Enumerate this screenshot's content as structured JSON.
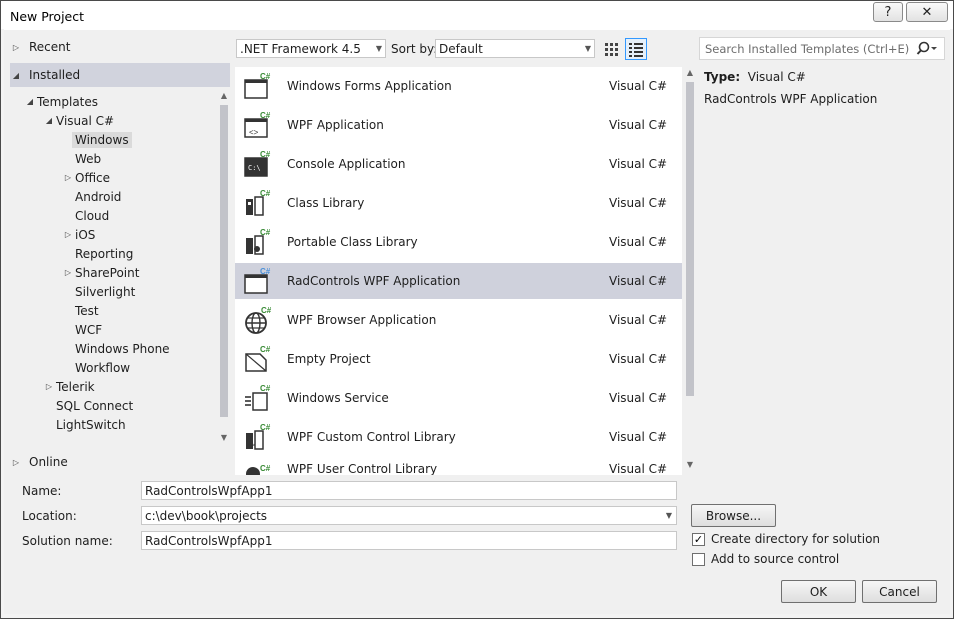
{
  "window": {
    "title": "New Project",
    "help": "?",
    "close": "✕"
  },
  "nav": {
    "recent": "Recent",
    "installed": "Installed",
    "online": "Online",
    "tree": [
      {
        "label": "Templates"
      },
      {
        "label": "Visual C#"
      },
      {
        "label": "Windows"
      },
      {
        "label": "Web"
      },
      {
        "label": "Office"
      },
      {
        "label": "Android"
      },
      {
        "label": "Cloud"
      },
      {
        "label": "iOS"
      },
      {
        "label": "Reporting"
      },
      {
        "label": "SharePoint"
      },
      {
        "label": "Silverlight"
      },
      {
        "label": "Test"
      },
      {
        "label": "WCF"
      },
      {
        "label": "Windows Phone"
      },
      {
        "label": "Workflow"
      },
      {
        "label": "Telerik"
      },
      {
        "label": "SQL Connect"
      },
      {
        "label": "LightSwitch"
      }
    ]
  },
  "toolbar": {
    "framework": ".NET Framework 4.5",
    "sort_label": "Sort by:",
    "sort_value": "Default",
    "search_placeholder": "Search Installed Templates (Ctrl+E)"
  },
  "templates": [
    {
      "name": "Windows Forms Application",
      "lang": "Visual C#",
      "icon": "winforms-icon"
    },
    {
      "name": "WPF Application",
      "lang": "Visual C#",
      "icon": "wpf-icon"
    },
    {
      "name": "Console Application",
      "lang": "Visual C#",
      "icon": "console-icon"
    },
    {
      "name": "Class Library",
      "lang": "Visual C#",
      "icon": "class-library-icon"
    },
    {
      "name": "Portable Class Library",
      "lang": "Visual C#",
      "icon": "portable-library-icon"
    },
    {
      "name": "RadControls WPF Application",
      "lang": "Visual C#",
      "icon": "radcontrols-icon"
    },
    {
      "name": "WPF Browser Application",
      "lang": "Visual C#",
      "icon": "globe-icon"
    },
    {
      "name": "Empty Project",
      "lang": "Visual C#",
      "icon": "empty-project-icon"
    },
    {
      "name": "Windows Service",
      "lang": "Visual C#",
      "icon": "service-icon"
    },
    {
      "name": "WPF Custom Control Library",
      "lang": "Visual C#",
      "icon": "control-library-icon"
    },
    {
      "name": "WPF User Control Library",
      "lang": "Visual C#",
      "icon": "user-control-icon"
    }
  ],
  "details": {
    "type_label": "Type:",
    "type_value": "Visual C#",
    "description": "RadControls WPF Application"
  },
  "form": {
    "name_label": "Name:",
    "name_value": "RadControlsWpfApp1",
    "location_label": "Location:",
    "location_value": "c:\\dev\\book\\projects",
    "solution_label": "Solution name:",
    "solution_value": "RadControlsWpfApp1",
    "browse": "Browse...",
    "create_dir": "Create directory for solution",
    "create_dir_checked": true,
    "source_control": "Add to source control",
    "source_control_checked": false,
    "ok": "OK",
    "cancel": "Cancel"
  },
  "colors": {
    "accent_green": "#388a34",
    "selection": "#cfd1dc",
    "rad_blue": "#4a90d9"
  }
}
